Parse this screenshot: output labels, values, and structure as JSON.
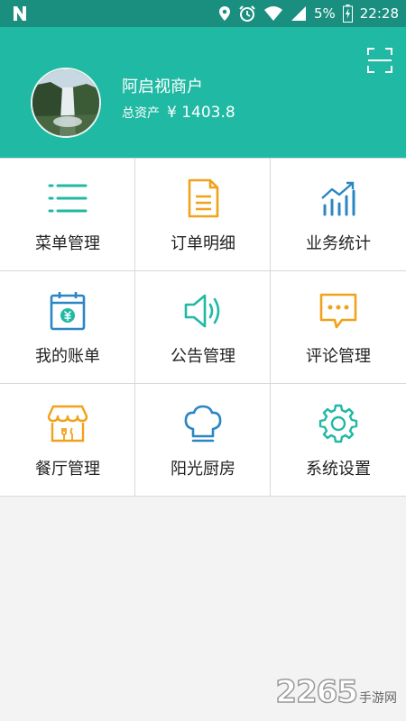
{
  "status_bar": {
    "battery": "5%",
    "time": "22:28",
    "icons": [
      "n-logo-icon",
      "location-icon",
      "alarm-icon",
      "wifi-icon",
      "signal-icon",
      "battery-icon"
    ]
  },
  "header": {
    "shop_name": "阿启视商户",
    "assets_label": "总资产",
    "assets_value": "¥ 1403.8",
    "scan_icon": "scan-icon"
  },
  "grid": {
    "items": [
      {
        "label": "菜单管理",
        "icon": "list-icon",
        "color": "#20b9a4"
      },
      {
        "label": "订单明细",
        "icon": "document-icon",
        "color": "#f0a21a"
      },
      {
        "label": "业务统计",
        "icon": "chart-icon",
        "color": "#2b86c5"
      },
      {
        "label": "我的账单",
        "icon": "calendar-bill-icon",
        "color": "#2b86c5"
      },
      {
        "label": "公告管理",
        "icon": "speaker-icon",
        "color": "#20b9a4"
      },
      {
        "label": "评论管理",
        "icon": "comment-icon",
        "color": "#f0a21a"
      },
      {
        "label": "餐厅管理",
        "icon": "restaurant-icon",
        "color": "#f0a21a"
      },
      {
        "label": "阳光厨房",
        "icon": "chef-hat-icon",
        "color": "#2b86c5"
      },
      {
        "label": "系统设置",
        "icon": "gear-icon",
        "color": "#20b9a4"
      }
    ]
  },
  "watermark": {
    "number": "2265",
    "text": "手游网"
  }
}
